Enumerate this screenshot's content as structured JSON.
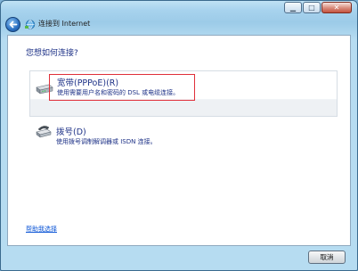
{
  "window": {
    "title": "连接到 Internet",
    "minimize": "▁",
    "maximize": "□",
    "close": "✕"
  },
  "main": {
    "question": "您想如何连接?",
    "options": [
      {
        "label": "宽带(PPPoE)(R)",
        "description": "使用需要用户名和密码的 DSL 或电缆连接。",
        "icon": "broadband-modem-icon"
      },
      {
        "label": "拨号(D)",
        "description": "使用拨号调制解调器或 ISDN 连接。",
        "icon": "dialup-phone-icon"
      }
    ],
    "help_link": "帮助我选择"
  },
  "footer": {
    "cancel_label": "取消"
  },
  "colors": {
    "heading": "#1e3287",
    "link": "#0a54d6",
    "highlight_border": "#e0303a"
  }
}
